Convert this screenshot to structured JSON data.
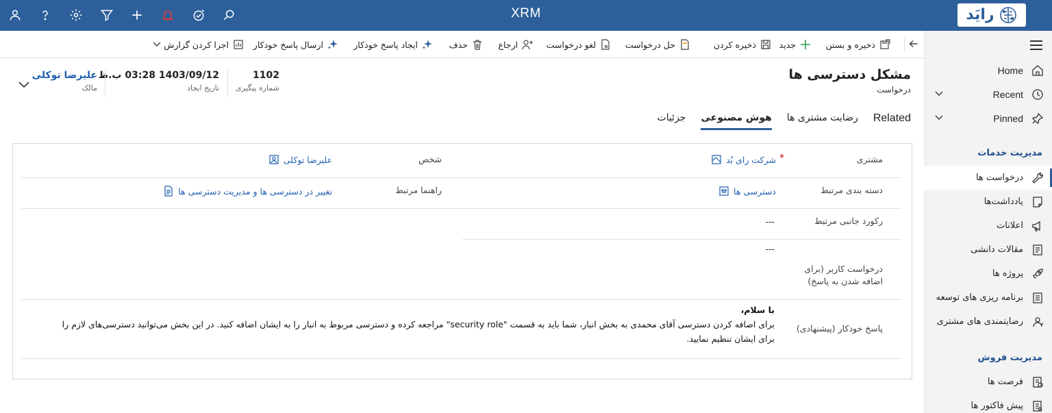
{
  "topbar": {
    "title": "XRM",
    "logo_text": "رایَد",
    "icons": [
      "user-icon",
      "help-icon",
      "settings-icon",
      "filter-icon",
      "add-icon",
      "notification-bell-icon",
      "task-check-icon",
      "search-icon"
    ],
    "colors": {
      "bar": "#2d5f9a",
      "bell": "#e23c3c"
    }
  },
  "sidebar": {
    "home": "Home",
    "recent": "Recent",
    "pinned": "Pinned",
    "section_services": "مدیریت خدمات",
    "items_services": [
      {
        "label": "درخواست ها",
        "icon": "wrench-icon"
      },
      {
        "label": "یادداشت‌ها",
        "icon": "note-icon"
      },
      {
        "label": "اعلانات",
        "icon": "megaphone-icon"
      },
      {
        "label": "مقالات دانشی",
        "icon": "article-icon"
      },
      {
        "label": "پروژه ها",
        "icon": "rocket-icon"
      },
      {
        "label": "برنامه ریزی های توسعه",
        "icon": "plan-icon"
      },
      {
        "label": "رضایتمندی های مشتری",
        "icon": "satisfaction-icon"
      }
    ],
    "section_sales": "مدیریت فروش",
    "items_sales": [
      {
        "label": "فرصت ها",
        "icon": "opportunity-icon"
      },
      {
        "label": "پیش فاکتور ها",
        "icon": "quote-icon"
      }
    ]
  },
  "commands": {
    "save_close": "ذخیره و بستن",
    "new": "جدید",
    "save": "ذخیره کردن",
    "resolve": "حل درخواست",
    "cancel": "لغو درخواست",
    "assign": "ارجاع",
    "delete": "حذف",
    "create_auto_reply": "ایجاد پاسخ خودکار",
    "send_auto_reply": "ارسال پاسخ خودکار",
    "run_report": "اجرا کردن گزارش"
  },
  "header": {
    "title": "مشکل دسترسی ها",
    "entity": "درخواست",
    "tracking_number": "1102",
    "tracking_label": "شماره پیگیری",
    "created_on": "1403/09/12 03:28 ب.ظ",
    "created_label": "تاریخ ایجاد",
    "owner": "علیرضا توکلی",
    "owner_label": "مالک"
  },
  "tabs": [
    {
      "label": "جزئیات",
      "active": false
    },
    {
      "label": "هوش مصنوعی",
      "active": true
    },
    {
      "label": "رضایت مشتری ها",
      "active": false
    },
    {
      "label": "Related",
      "active": false
    }
  ],
  "form": {
    "customer_label": "مشتری",
    "customer_value": "شرکت رای بُد",
    "person_label": "شخص",
    "person_value": "علیرضا توکلی",
    "category_label": "دسته بندی مرتبط",
    "category_value": "دسترسی ها",
    "guide_label": "راهنما مرتبط",
    "guide_value": "تغییر در دسترسی ها و مدیریت دسترسی ها",
    "side_record_label": "رکورد جانبی مرتبط",
    "side_record_value": "---",
    "user_request_label": "درخواست کاربر (برای اضافه شدن به پاسخ)",
    "user_request_value": "---",
    "auto_reply_label": "پاسخ خودکار (پیشنهادی)",
    "auto_reply_greeting": "با سلام،",
    "auto_reply_body": "برای اضافه کردن دسترسی آقای محمدی به بخش انبار، شما باید به قسمت \"security role\" مراجعه کرده و دسترسی مربوط به انبار را به ایشان اضافه کنید. در این بخش می‌توانید دسترسی‌های لازم را برای ایشان تنظیم نمایید."
  }
}
